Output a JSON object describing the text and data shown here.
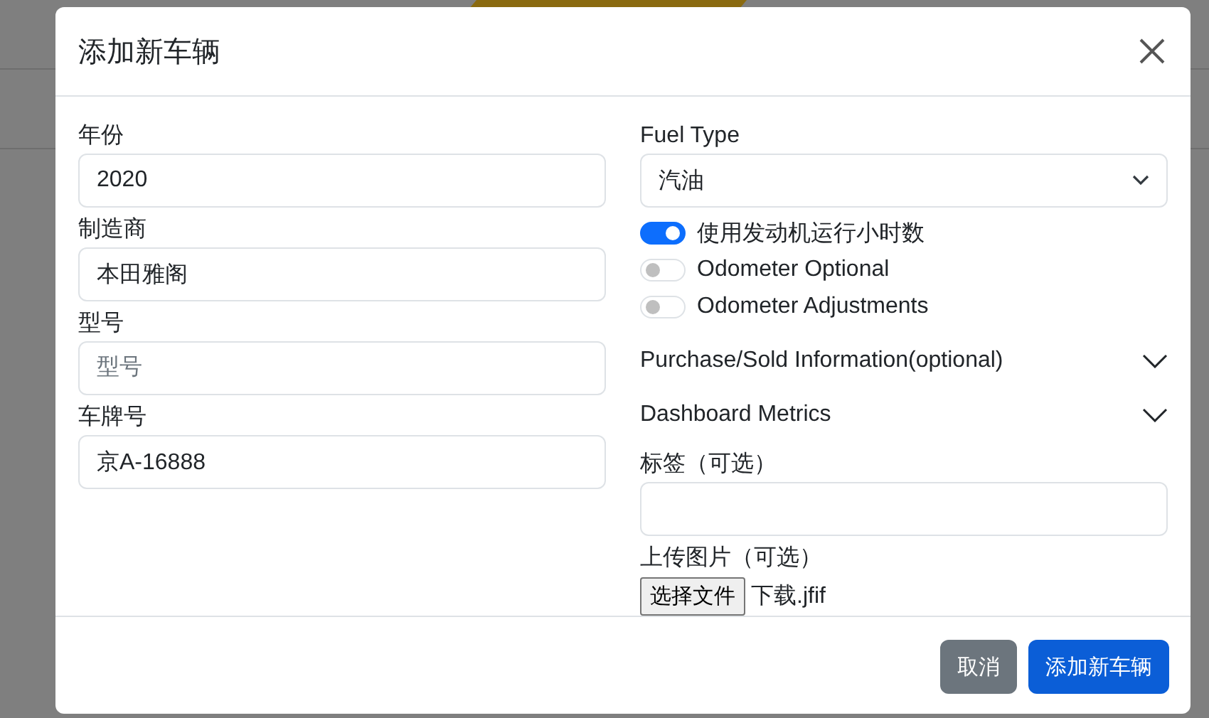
{
  "dialog": {
    "title": "添加新车辆"
  },
  "left_fields": [
    {
      "label": "年份",
      "value": "2020"
    },
    {
      "label": "制造商",
      "value": "本田雅阁"
    },
    {
      "label": "型号",
      "placeholder": "型号"
    },
    {
      "label": "车牌号",
      "value": "京A-16888"
    }
  ],
  "fuel_type": {
    "label": "Fuel Type",
    "value": "汽油"
  },
  "switches": [
    {
      "label": "使用发动机运行小时数",
      "on": true
    },
    {
      "label": "Odometer Optional",
      "on": false
    },
    {
      "label": "Odometer Adjustments",
      "on": false
    }
  ],
  "sections": [
    {
      "label": "Purchase/Sold Information(optional)",
      "expanded": false
    },
    {
      "label": "Dashboard Metrics",
      "expanded": false
    }
  ],
  "tags": {
    "label": "标签（可选）"
  },
  "upload": {
    "label": "上传图片（可选）",
    "button": "选择文件",
    "file_name": "下载.jfif"
  },
  "buttons": [
    {
      "label": "取消",
      "kind": "secondary"
    },
    {
      "label": "添加新车辆",
      "kind": "primary"
    }
  ]
}
